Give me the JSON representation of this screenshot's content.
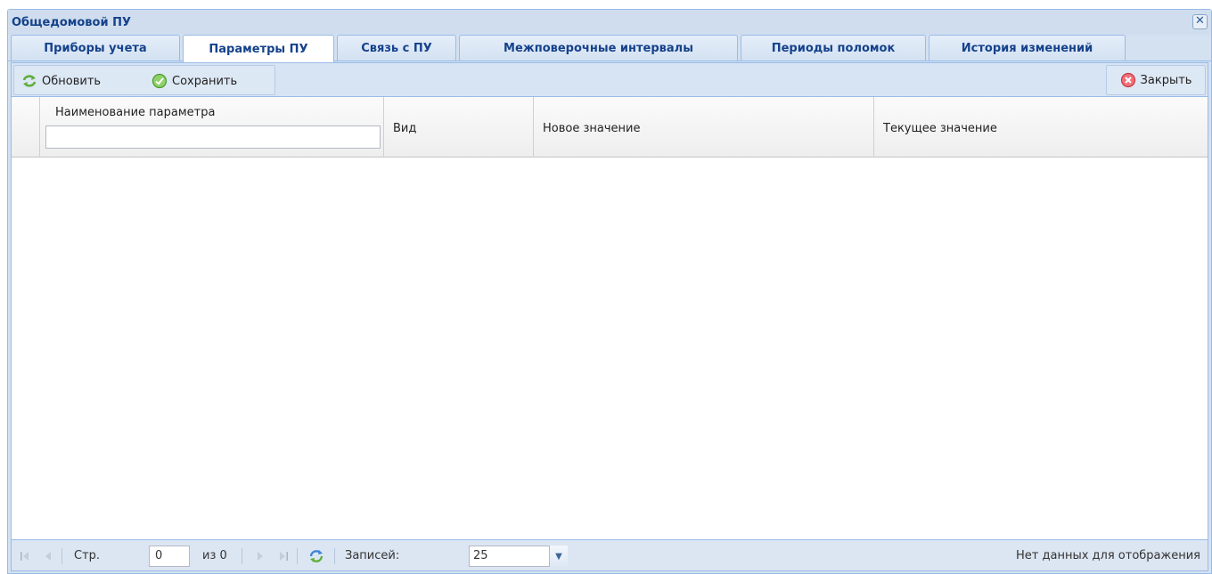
{
  "window": {
    "title": "Общедомовой ПУ",
    "close_symbol": "✕"
  },
  "tabs": [
    {
      "label": "Приборы учета",
      "active": false
    },
    {
      "label": "Параметры ПУ",
      "active": true
    },
    {
      "label": "Связь с ПУ",
      "active": false
    },
    {
      "label": "Межповерочные интервалы",
      "active": false
    },
    {
      "label": "Периоды поломок",
      "active": false
    },
    {
      "label": "История изменений",
      "active": false
    }
  ],
  "toolbar": {
    "refresh_label": "Обновить",
    "save_label": "Сохранить",
    "close_label": "Закрыть"
  },
  "grid": {
    "columns": [
      "Наименование параметра",
      "Вид",
      "Новое значение",
      "Текущее значение"
    ],
    "filter_value": "",
    "rows": []
  },
  "pager": {
    "page_label": "Стр.",
    "page_value": "0",
    "of_label": "из 0",
    "records_label": "Записей:",
    "records_value": "25",
    "status": "Нет данных для отображения"
  },
  "colors": {
    "title": "#15428b",
    "border": "#99bbe8",
    "toolbar_bg": "#d7e4f3"
  }
}
